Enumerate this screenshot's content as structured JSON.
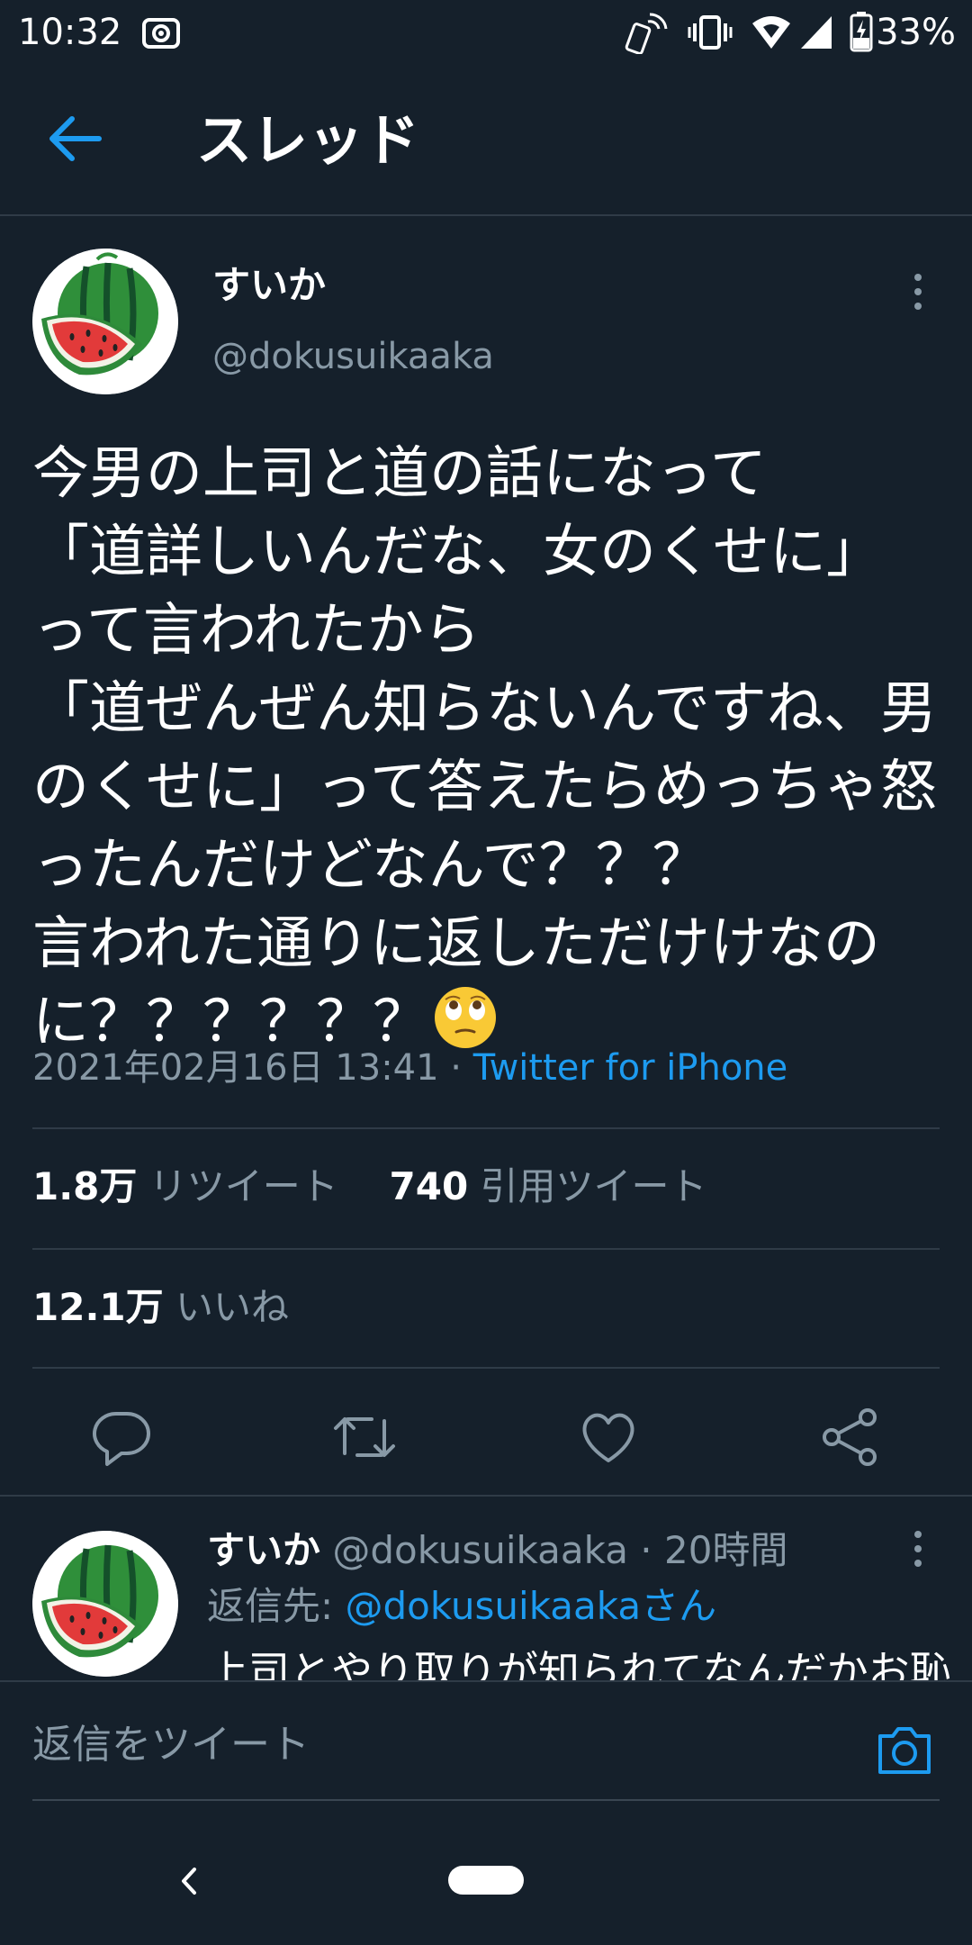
{
  "status_bar": {
    "time": "10:32",
    "battery": "33%",
    "icons": [
      "screen-record-icon",
      "nfc-icon",
      "vibrate-icon",
      "wifi-icon",
      "signal-icon",
      "battery-icon"
    ]
  },
  "header": {
    "title": "スレッド",
    "back_icon": "back-arrow-icon"
  },
  "main_tweet": {
    "display_name": "すいか",
    "handle": "@dokusuikaaka",
    "text": "今男の上司と道の話になって\n「道詳しいんだな、女のくせに」\nって言われたから\n「道ぜんぜん知らないんですね、男のくせに」って答えたらめっちゃ怒ったんだけどなんで？？？\n言われた通りに返しただけけなのに？？？？？？",
    "emoji": "eye-roll-emoji",
    "timestamp": "2021年02月16日 13:41",
    "separator": " · ",
    "source": "Twitter for iPhone",
    "stats": {
      "retweets_count": "1.8万",
      "retweets_label": "リツイート",
      "quotes_count": "740",
      "quotes_label": "引用ツイート",
      "likes_count": "12.1万",
      "likes_label": "いいね"
    }
  },
  "reply_tweet": {
    "display_name": "すいか",
    "handle": "@dokusuikaaka",
    "separator": " · ",
    "time_ago": "20時間",
    "reply_prefix": "返信先: ",
    "reply_target": "@dokusuikaakaさん",
    "text": "上司とやり取りが知られてなんだかお恥"
  },
  "composer": {
    "placeholder": "返信をツイート"
  },
  "colors": {
    "background": "#15202b",
    "accent": "#1d9bf0",
    "muted": "#8899a6",
    "divider": "#2f3b47"
  }
}
